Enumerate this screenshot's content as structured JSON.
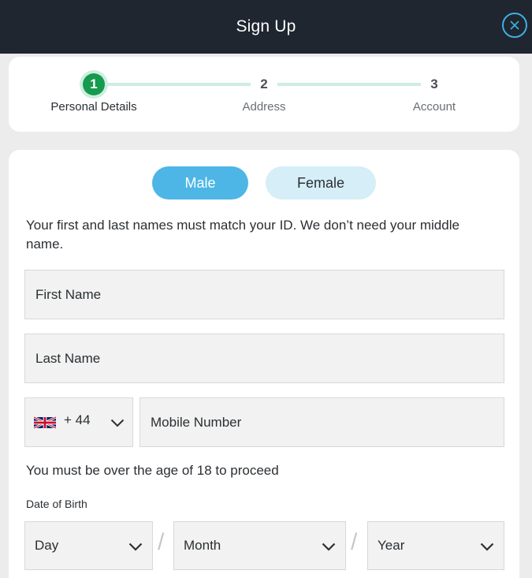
{
  "header": {
    "title": "Sign Up",
    "close_icon": "close-icon"
  },
  "steps": [
    {
      "number": "1",
      "label": "Personal Details",
      "state": "active"
    },
    {
      "number": "2",
      "label": "Address",
      "state": "pending"
    },
    {
      "number": "3",
      "label": "Account",
      "state": "pending"
    }
  ],
  "gender": {
    "male_label": "Male",
    "female_label": "Female",
    "selected": "Male"
  },
  "form": {
    "name_help": "Your first and last names must match your ID. We don’t need your middle name.",
    "first_name_placeholder": "First Name",
    "last_name_placeholder": "Last Name",
    "phone_code": "+ 44",
    "phone_flag": "uk-flag-icon",
    "mobile_placeholder": "Mobile Number",
    "age_notice": "You must be over the age of 18 to proceed",
    "dob_label": "Date of Birth",
    "dob_day": "Day",
    "dob_month": "Month",
    "dob_year": "Year"
  },
  "colors": {
    "header_bg": "#1f2630",
    "accent_blue": "#4db6e6",
    "step_active": "#169a4e",
    "step_line": "#cdeee0"
  }
}
